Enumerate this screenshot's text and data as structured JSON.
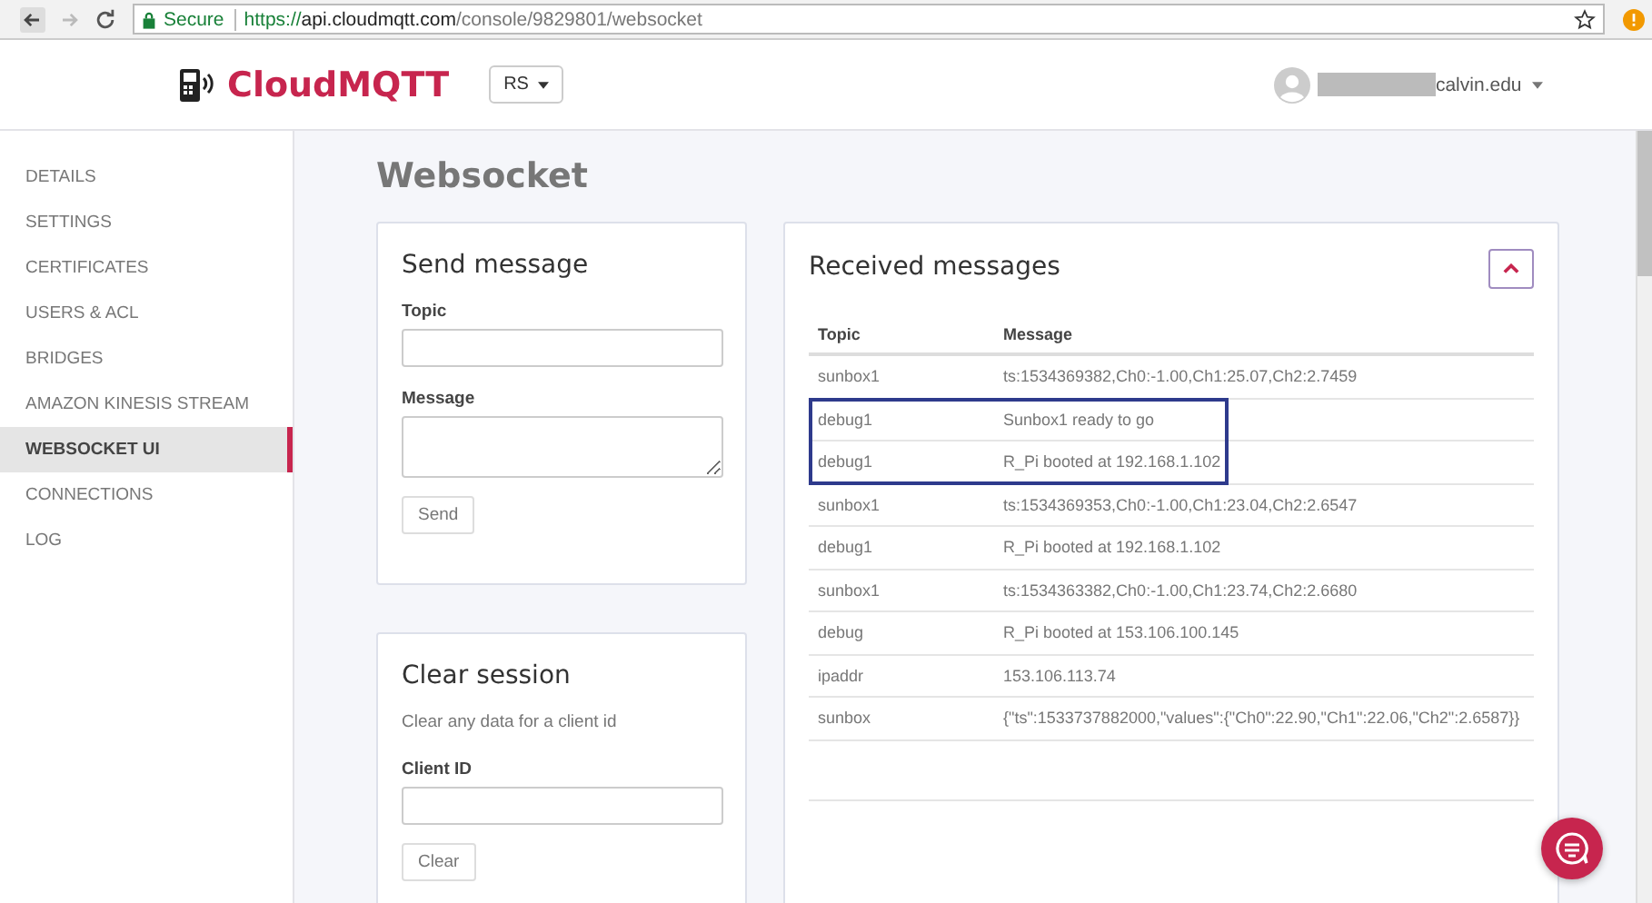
{
  "browser": {
    "security_label": "Secure",
    "url_scheme": "https://",
    "url_host": "api.cloudmqtt.com",
    "url_path": "/console/9829801/websocket"
  },
  "header": {
    "logo": "CloudMQTT",
    "region_dropdown": "RS",
    "user_email": "calvin.edu"
  },
  "sidebar": {
    "items": [
      {
        "label": "DETAILS",
        "selected": false
      },
      {
        "label": "SETTINGS",
        "selected": false
      },
      {
        "label": "CERTIFICATES",
        "selected": false
      },
      {
        "label": "USERS & ACL",
        "selected": false
      },
      {
        "label": "BRIDGES",
        "selected": false
      },
      {
        "label": "AMAZON KINESIS STREAM",
        "selected": false
      },
      {
        "label": "WEBSOCKET UI",
        "selected": true
      },
      {
        "label": "CONNECTIONS",
        "selected": false
      },
      {
        "label": "LOG",
        "selected": false
      }
    ]
  },
  "page_title": "Websocket",
  "send_message": {
    "title": "Send message",
    "fields": [
      {
        "label": "Topic",
        "kind": "input"
      },
      {
        "label": "Message",
        "kind": "textarea"
      }
    ],
    "button": "Send"
  },
  "clear_session": {
    "title": "Clear session",
    "description": "Clear any data for a client id",
    "fields": [
      {
        "label": "Client ID",
        "kind": "input"
      }
    ],
    "button": "Clear"
  },
  "received_messages": {
    "title": "Received messages",
    "expanded": true,
    "columns": [
      "Topic",
      "Message"
    ],
    "rows": [
      {
        "topic": "sunbox1",
        "message": "ts:1534369382,Ch0:-1.00,Ch1:25.07,Ch2:2.7459",
        "highlighted": false
      },
      {
        "topic": "debug1",
        "message": "Sunbox1 ready to go",
        "highlighted": true
      },
      {
        "topic": "debug1",
        "message": "R_Pi booted at 192.168.1.102",
        "highlighted": true
      },
      {
        "topic": "sunbox1",
        "message": "ts:1534369353,Ch0:-1.00,Ch1:23.04,Ch2:2.6547",
        "highlighted": false
      },
      {
        "topic": "debug1",
        "message": "R_Pi booted at 192.168.1.102",
        "highlighted": false
      },
      {
        "topic": "sunbox1",
        "message": "ts:1534363382,Ch0:-1.00,Ch1:23.74,Ch2:2.6680",
        "highlighted": false
      },
      {
        "topic": "debug",
        "message": "R_Pi booted at 153.106.100.145",
        "highlighted": false
      },
      {
        "topic": "ipaddr",
        "message": "153.106.113.74",
        "highlighted": false
      },
      {
        "topic": "sunbox",
        "message": "{\"ts\":1533737882000,\"values\":{\"Ch0\":22.90,\"Ch1\":22.06,\"Ch2\":2.6587}}",
        "highlighted": false
      }
    ]
  }
}
